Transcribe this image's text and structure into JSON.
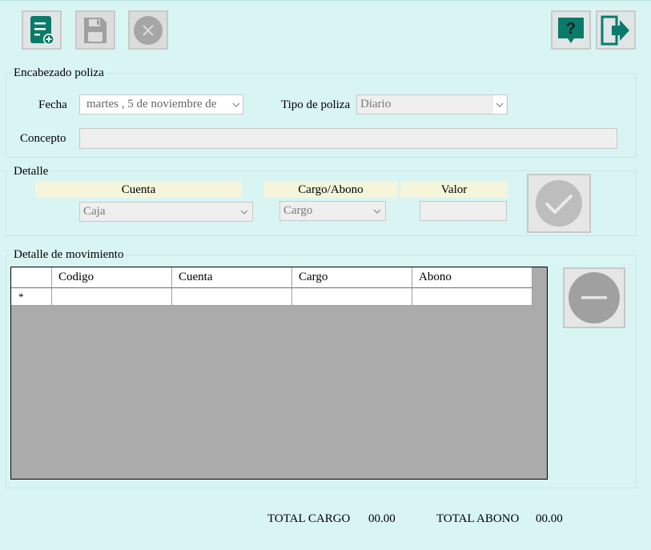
{
  "toolbar": {
    "new_icon": "new-document-icon",
    "save_icon": "floppy-disk-icon",
    "cancel_icon": "close-icon",
    "help_icon": "help-icon",
    "exit_icon": "exit-icon",
    "accent": "#0b7a6a"
  },
  "header_group": {
    "title": "Encabezado poliza",
    "fecha_label": "Fecha",
    "fecha_value": "martes  ,   5 de noviembre  de",
    "tipo_label": "Tipo de poliza",
    "tipo_value": "Diario",
    "concepto_label": "Concepto",
    "concepto_value": ""
  },
  "detalle_group": {
    "title": "Detalle",
    "cuenta_header": "Cuenta",
    "cargo_abono_header": "Cargo/Abono",
    "valor_header": "Valor",
    "cuenta_value": "Caja",
    "cargo_abono_value": "Cargo",
    "valor_value": ""
  },
  "movimiento_group": {
    "title": "Detalle de movimiento",
    "columns": [
      "Codigo",
      "Cuenta",
      "Cargo",
      "Abono"
    ],
    "new_row_marker": "*"
  },
  "totals": {
    "cargo_label": "TOTAL CARGO",
    "cargo_value": "00.00",
    "abono_label": "TOTAL ABONO",
    "abono_value": "00.00"
  }
}
